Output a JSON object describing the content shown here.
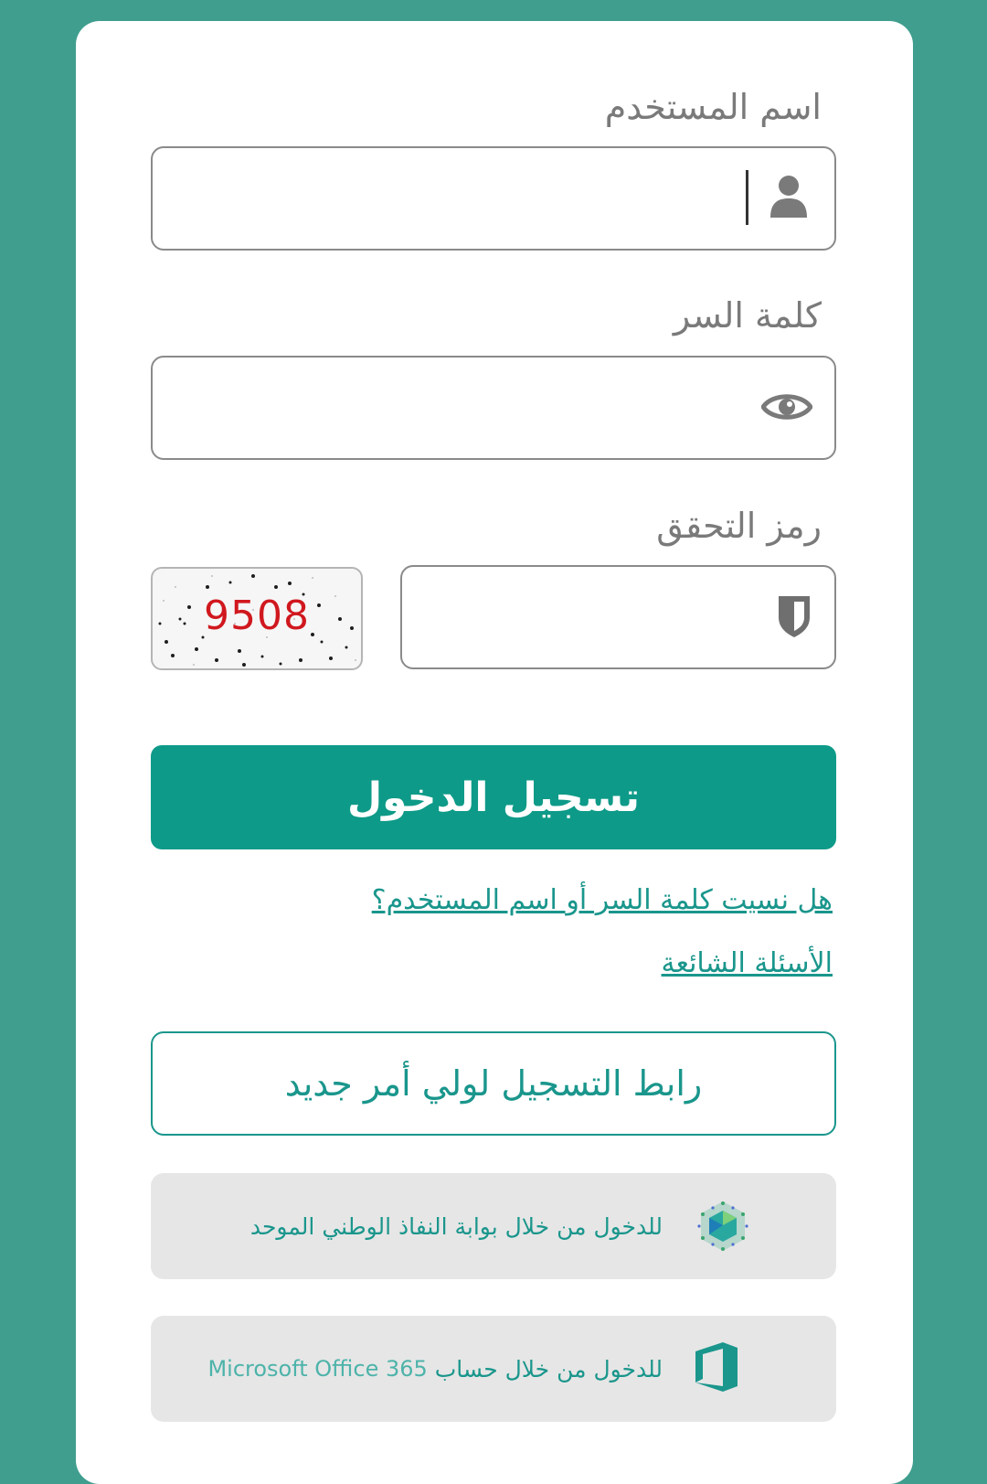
{
  "form": {
    "username_label": "اسم المستخدم",
    "username_value": "",
    "password_label": "كلمة السر",
    "password_value": "",
    "captcha_label": "رمز التحقق",
    "captcha_value": "",
    "captcha_code": "9508"
  },
  "actions": {
    "login_label": "تسجيل الدخول",
    "forgot_link": "هل نسيت كلمة السر أو اسم المستخدم؟",
    "faq_link": "الأسئلة الشائعة",
    "register_label": "رابط التسجيل لولي أمر جديد",
    "nafath_label": "للدخول من خلال بوابة النفاذ الوطني الموحد",
    "office_label": "للدخول من خلال حساب",
    "office_brand": "Microsoft Office 365"
  },
  "icons": {
    "username": "user-icon",
    "password": "eye-icon",
    "captcha": "shield-icon",
    "nafath": "nafath-logo-icon",
    "office": "office-365-icon"
  },
  "colors": {
    "background": "#3f9e8e",
    "primary": "#0e9a88",
    "link": "#1a968c",
    "captcha_text": "#d0181e"
  }
}
